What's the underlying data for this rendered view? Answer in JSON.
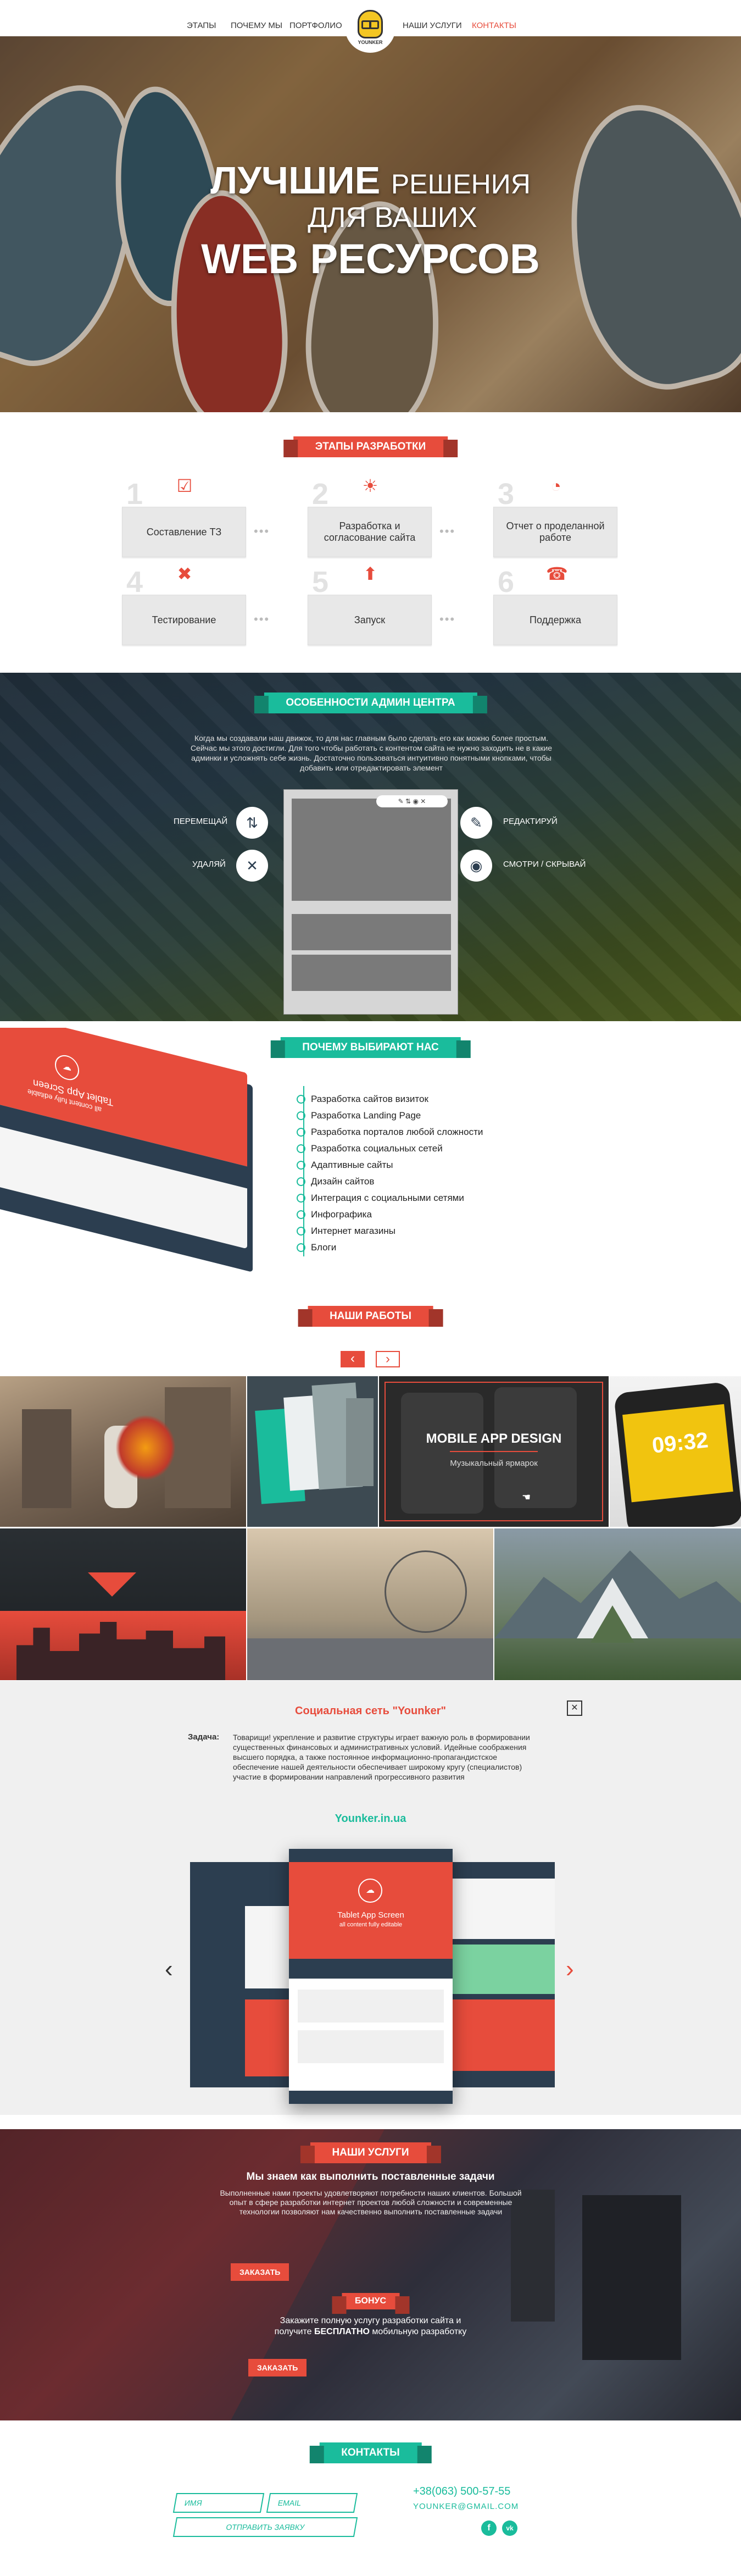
{
  "nav": {
    "left": [
      "ЭТАПЫ",
      "ПОЧЕМУ МЫ",
      "ПОРТФОЛИО"
    ],
    "right": [
      "НАШИ УСЛУГИ",
      "КОНТАКТЫ"
    ],
    "logo_text": "YOUNKER"
  },
  "hero": {
    "line1_big": "ЛУЧШИЕ",
    "line1_small": "РЕШЕНИЯ",
    "line2": "ДЛЯ ВАШИХ",
    "line3": "WEB РЕСУРСОВ"
  },
  "steps": {
    "title": "ЭТАПЫ РАЗРАБОТКИ",
    "items": [
      {
        "num": "1",
        "icon": "checklist-icon",
        "label": "Составление ТЗ"
      },
      {
        "num": "2",
        "icon": "lightbulb-icon",
        "label": "Разработка и согласование сайта"
      },
      {
        "num": "3",
        "icon": "clock-icon",
        "label": "Отчет о проделанной работе"
      },
      {
        "num": "4",
        "icon": "tools-icon",
        "label": "Тестирование"
      },
      {
        "num": "5",
        "icon": "rocket-icon",
        "label": "Запуск"
      },
      {
        "num": "6",
        "icon": "support-icon",
        "label": "Поддержка"
      }
    ]
  },
  "admin": {
    "title": "ОСОБЕННОСТИ АДМИН ЦЕНТРА",
    "text": "Когда мы создавали наш движок, то для нас главным было сделать его как можно более простым. Сейчас мы этого достигли. Для того чтобы работать с контентом сайта не нужно заходить не в какие админки и усложнять себе жизнь. Достаточно пользоваться интуитивно понятными кнопками, чтобы добавить или отредактировать элемент",
    "left": [
      "ПЕРЕМЕЩАЙ",
      "УДАЛЯЙ"
    ],
    "right": [
      "РЕДАКТИРУЙ",
      "СМОТРИ / СКРЫВАЙ"
    ]
  },
  "why": {
    "title": "ПОЧЕМУ ВЫБИРАЮТ НАС",
    "items": [
      "Разработка сайтов визиток",
      "Разработка Landing Page",
      "Разработка порталов любой сложности",
      "Разработка социальных сетей",
      "Адаптивные сайты",
      "Дизайн сайтов",
      "Интеграция с социальными сетями",
      "Инфографика",
      "Интернет магазины",
      "Блоги"
    ],
    "mock_title": "Tablet App Screen",
    "mock_sub": "all content fully editable"
  },
  "works": {
    "title": "НАШИ РАБОТЫ",
    "prev": "‹",
    "next": "›",
    "featured_title": "MOBILE APP DESIGN",
    "featured_sub": "Музыкальный ярмарок",
    "clock": "09:32"
  },
  "detail": {
    "title": "Социальная сеть \"Younker\"",
    "task_label": "Задача:",
    "task_text": "Товарищи! укрепление и развитие структуры играет важную роль в формировании существенных финансовых и административных условий. Идейные соображения высшего порядка, а также постоянное информационно-пропагандистское обеспечение нашей деятельности обеспечивает широкому кругу (специалистов) участие в формировании направлений прогрессивного развития",
    "link": "Younker.in.ua",
    "mock_title": "Tablet App Screen",
    "mock_sub": "all content fully editable",
    "close": "✕",
    "prev": "‹",
    "next": "›"
  },
  "services": {
    "title": "НАШИ УСЛУГИ",
    "subtitle": "Мы знаем как выполнить поставленные задачи",
    "text": "Выполненные нами проекты удовлетворяют потребности наших клиентов. Большой опыт в сфере разработки интернет проектов любой сложности и современные технологии позволяют нам качественно выполнить поставленные задачи",
    "order1": "ЗАКАЗАТЬ",
    "bonus_title": "БОНУС",
    "bonus_text_1": "Закажите полную услугу разработки сайта и",
    "bonus_text_2a": "получите ",
    "bonus_text_2b": "БЕСПЛАТНО",
    "bonus_text_2c": " мобильную разработку",
    "order2": "ЗАКАЗАТЬ"
  },
  "contacts": {
    "title": "КОНТАКТЫ",
    "name_placeholder": "ИМЯ",
    "email_placeholder": "EMAIL",
    "submit": "ОТПРАВИТЬ ЗАЯВКУ",
    "phone": "+38(063) 500-57-55",
    "email": "YOUNKER@GMAIL.COM",
    "social": [
      "f",
      "vk"
    ]
  },
  "colors": {
    "accent_red": "#e74c3c",
    "accent_green": "#1abc9c"
  }
}
